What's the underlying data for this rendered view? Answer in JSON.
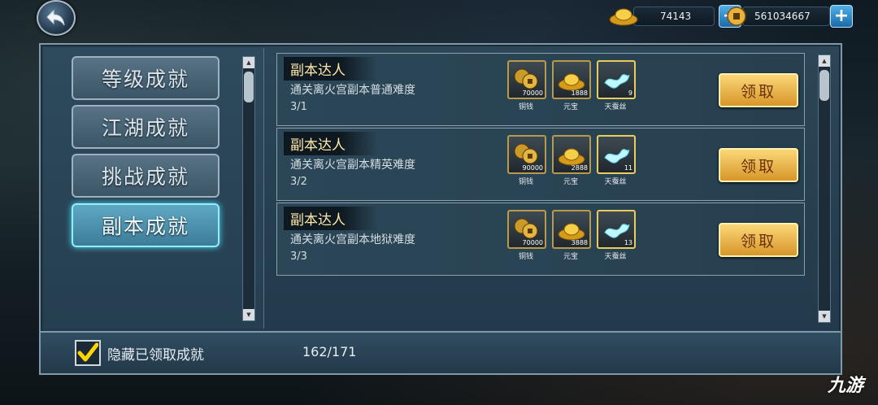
{
  "currency": {
    "gold_ingot": {
      "value": "74143",
      "icon": "gold-ingot-icon"
    },
    "copper_coin": {
      "value": "561034667",
      "icon": "copper-coin-icon"
    }
  },
  "categories": [
    {
      "label": "等级成就",
      "active": false
    },
    {
      "label": "江湖成就",
      "active": false
    },
    {
      "label": "挑战成就",
      "active": false
    },
    {
      "label": "副本成就",
      "active": true
    }
  ],
  "achievements": [
    {
      "title": "副本达人",
      "description": "通关离火宫副本普通难度",
      "progress": "3/1",
      "rewards": [
        {
          "name": "铜钱",
          "count": "70000",
          "icon": "copper-coins-icon"
        },
        {
          "name": "元宝",
          "count": "1888",
          "icon": "gold-ingot-icon"
        },
        {
          "name": "天蚕丝",
          "count": "9",
          "icon": "silk-icon"
        }
      ],
      "claim_label": "领取"
    },
    {
      "title": "副本达人",
      "description": "通关离火宫副本精英难度",
      "progress": "3/2",
      "rewards": [
        {
          "name": "铜钱",
          "count": "90000",
          "icon": "copper-coins-icon"
        },
        {
          "name": "元宝",
          "count": "2888",
          "icon": "gold-ingot-icon"
        },
        {
          "name": "天蚕丝",
          "count": "11",
          "icon": "silk-icon"
        }
      ],
      "claim_label": "领取"
    },
    {
      "title": "副本达人",
      "description": "通关离火宫副本地狱难度",
      "progress": "3/3",
      "rewards": [
        {
          "name": "铜钱",
          "count": "70000",
          "icon": "copper-coins-icon"
        },
        {
          "name": "元宝",
          "count": "3888",
          "icon": "gold-ingot-icon"
        },
        {
          "name": "天蚕丝",
          "count": "13",
          "icon": "silk-icon"
        }
      ],
      "claim_label": "领取"
    }
  ],
  "footer": {
    "hide_claimed_label": "隐藏已领取成就",
    "hide_claimed_checked": true,
    "completed_count": "162/171"
  },
  "watermark": "九游",
  "colors": {
    "accent_gold": "#e8b640",
    "active_cyan": "#8ef0ff"
  }
}
